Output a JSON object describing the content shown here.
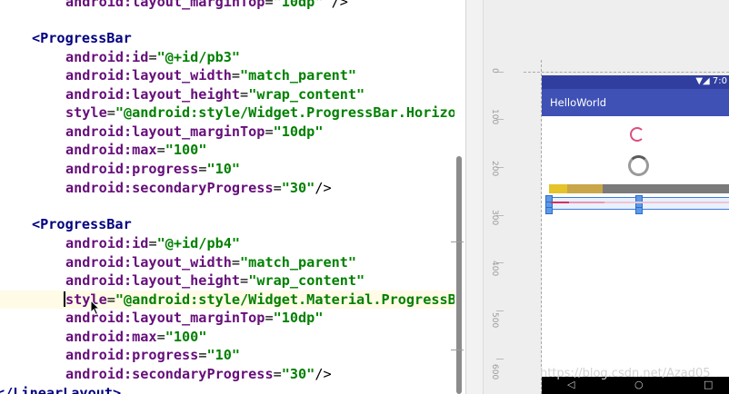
{
  "editor": {
    "lines": [
      {
        "attr": "android:layout_marginTop",
        "value": "\"10dp\"",
        "end": " />"
      },
      {
        "open": "<ProgressBar"
      },
      {
        "attr": "android:id",
        "value": "\"@+id/pb3\""
      },
      {
        "attr": "android:layout_width",
        "value": "\"match_parent\""
      },
      {
        "attr": "android:layout_height",
        "value": "\"wrap_content\""
      },
      {
        "attr": "style",
        "value": "\"@android:style/Widget.ProgressBar.Horizo"
      },
      {
        "attr": "android:layout_marginTop",
        "value": "\"10dp\""
      },
      {
        "attr": "android:max",
        "value": "\"100\""
      },
      {
        "attr": "android:progress",
        "value": "\"10\""
      },
      {
        "attr": "android:secondaryProgress",
        "value": "\"30\"",
        "end": "/>"
      },
      {
        "open": "<ProgressBar"
      },
      {
        "attr": "android:id",
        "value": "\"@+id/pb4\""
      },
      {
        "attr": "android:layout_width",
        "value": "\"match_parent\""
      },
      {
        "attr": "android:layout_height",
        "value": "\"wrap_content\""
      },
      {
        "attr": "style",
        "value": "\"@android:style/Widget.Material.ProgressB"
      },
      {
        "attr": "android:layout_marginTop",
        "value": "\"10dp\""
      },
      {
        "attr": "android:max",
        "value": "\"100\""
      },
      {
        "attr": "android:progress",
        "value": "\"10\""
      },
      {
        "attr": "android:secondaryProgress",
        "value": "\"30\"",
        "end": "/>"
      },
      {
        "close": "</LinearLayout>"
      }
    ]
  },
  "ruler": {
    "labels": [
      "0",
      "100",
      "200",
      "300",
      "400",
      "500",
      "600"
    ]
  },
  "preview": {
    "app_title": "HelloWorld",
    "status_time": "7:0",
    "status_icons": "▼◢",
    "progress_bar": {
      "max": 100,
      "progress": 10,
      "secondary_progress": 30
    },
    "material_bar": {
      "max": 100,
      "progress": 10,
      "secondary_progress": 30
    },
    "nav": {
      "back": "◁",
      "home": "○",
      "recents": "□"
    }
  },
  "watermark": "https://blog.csdn.net/Azad05",
  "colors": {
    "tag": "#000080",
    "attribute": "#660e7a",
    "value": "#008000",
    "action_bar": "#3f51b5",
    "status_bar": "#303f9f",
    "accent": "#e04d7a"
  }
}
